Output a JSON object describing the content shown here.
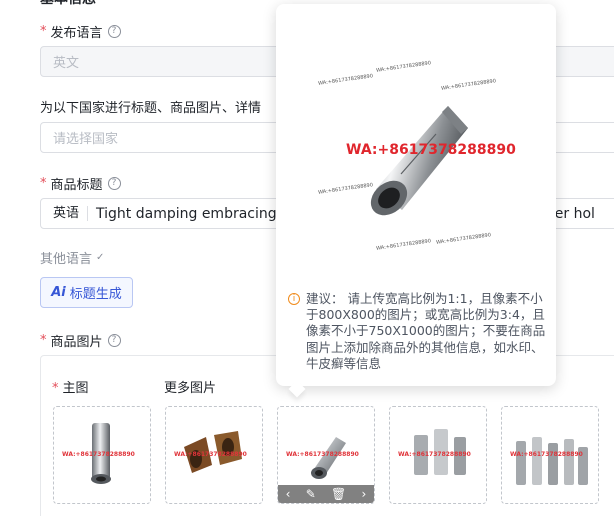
{
  "section": {
    "title": "基本信息"
  },
  "publish_language": {
    "label": "发布语言",
    "value": "英文"
  },
  "countries": {
    "label": "为以下国家进行标题、商品图片、详情",
    "placeholder": "请选择国家"
  },
  "product_title": {
    "label": "商品标题",
    "lang_prefix": "英语",
    "value": "Tight damping embracing",
    "value_tail": "nner hol"
  },
  "other_languages": {
    "label": "其他语言",
    "chevron": "✓"
  },
  "ai_button": {
    "icon_text": "Ai",
    "label": "标题生成"
  },
  "product_images": {
    "label": "商品图片",
    "main_label": "主图",
    "more_label": "更多图片",
    "watermark": "WA:+8617378288890",
    "thumb_watermark": "WA:+8617378288890",
    "toolbar": {
      "prev": "‹",
      "edit": "✎",
      "delete": "🗑",
      "next": "›"
    }
  },
  "popover": {
    "watermark": "WA:+8617378288890",
    "small_watermark": "WA:+8617378288890",
    "tip": "建议： 请上传宽高比例为1:1，且像素不小于800X800的图片；或宽高比例为3:4，且像素不小于750X1000的图片；不要在商品图片上添加除商品外的其他信息，如水印、牛皮癣等信息"
  },
  "colors": {
    "required": "#e34d59",
    "accent": "#3656d6",
    "watermark_red": "#e0262d",
    "warning": "#f08c1d"
  }
}
